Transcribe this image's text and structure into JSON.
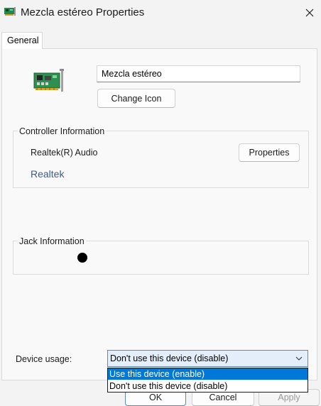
{
  "window": {
    "title": "Mezcla estéreo Properties",
    "close_glyph": "✕"
  },
  "tabs": [
    {
      "label": "General",
      "selected": true
    }
  ],
  "device": {
    "icon": "sound-card-icon",
    "name_value": "Mezcla estéreo",
    "change_icon_label": "Change Icon"
  },
  "controller": {
    "group_label": "Controller Information",
    "name": "Realtek(R) Audio",
    "vendor_link": "Realtek",
    "properties_label": "Properties"
  },
  "jack": {
    "group_label": "Jack Information",
    "indicator_color": "#000000"
  },
  "usage": {
    "label": "Device usage:",
    "selected": "Don't use this device (disable)",
    "options": [
      {
        "label": "Use this device (enable)",
        "highlighted": true
      },
      {
        "label": "Don't use this device (disable)",
        "highlighted": false
      }
    ]
  },
  "buttons": {
    "ok": "OK",
    "cancel": "Cancel",
    "apply": "Apply"
  },
  "colors": {
    "accent": "#0078d7",
    "link": "#3d5a8c",
    "select_focus": "#e3eefa"
  }
}
